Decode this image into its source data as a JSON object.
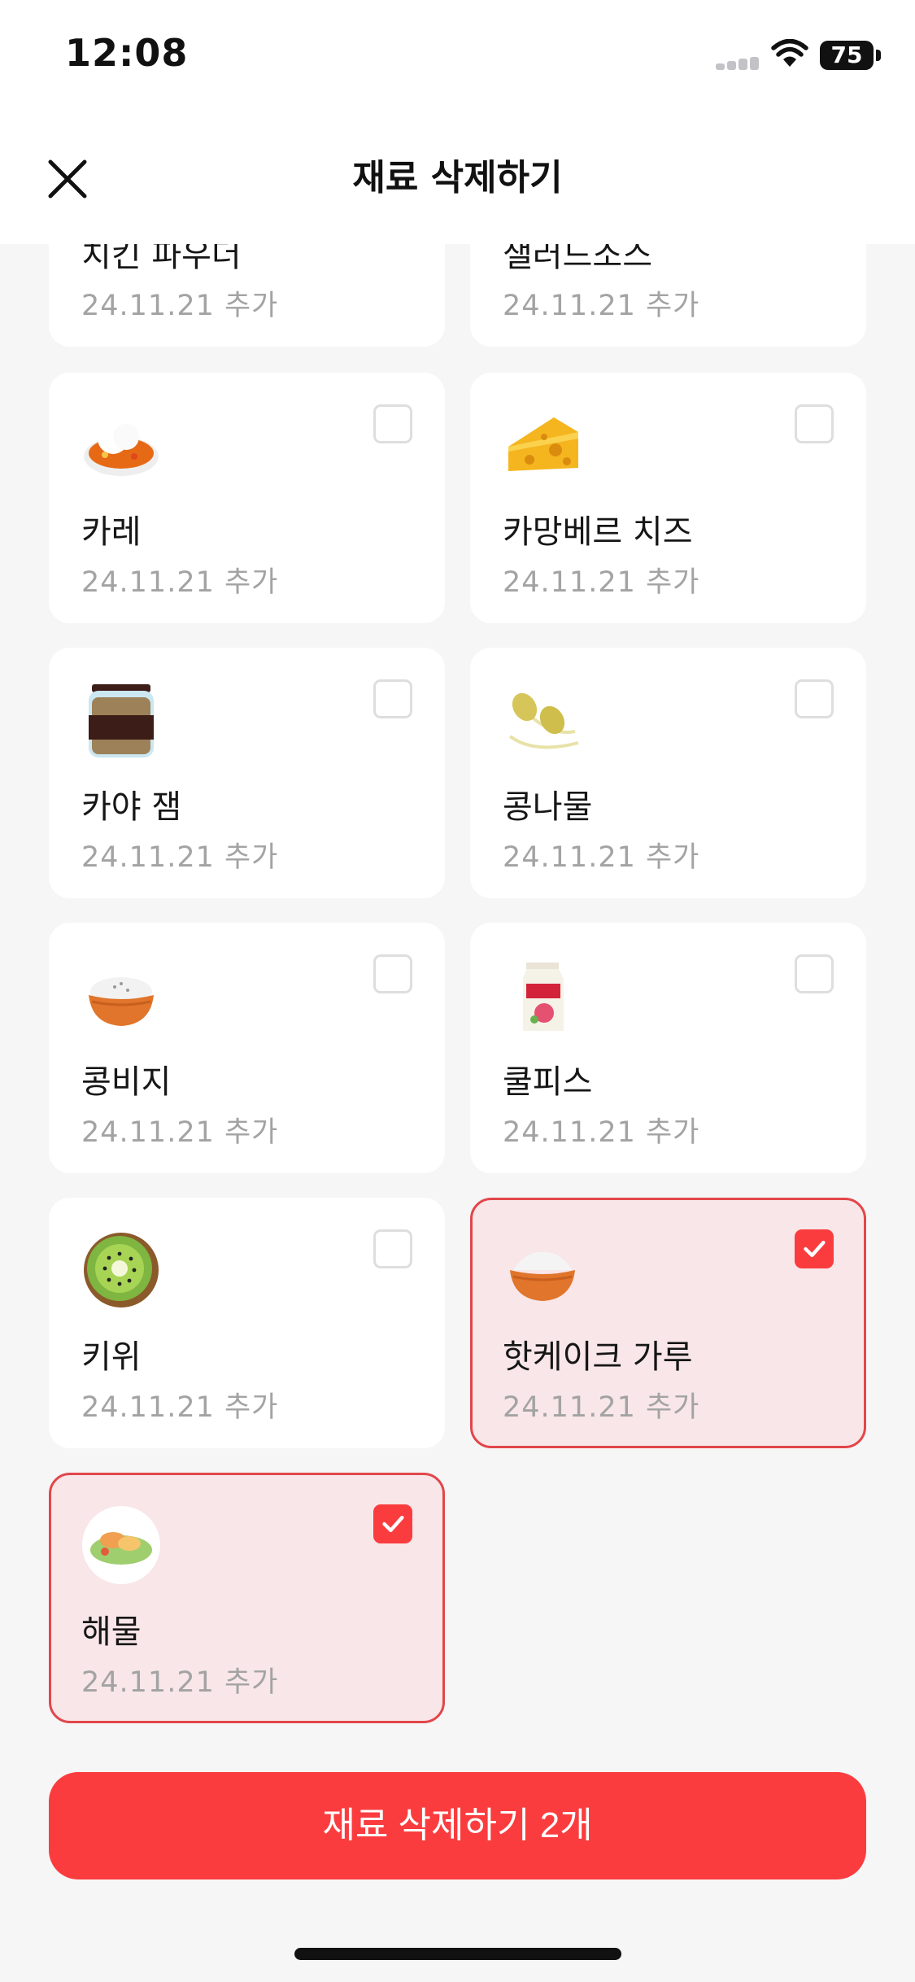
{
  "status_bar": {
    "time": "12:08",
    "battery": "75",
    "icons": [
      "signal-icon",
      "wifi-icon",
      "battery-icon"
    ]
  },
  "nav": {
    "title": "재료 삭제하기",
    "close_icon": "close-icon"
  },
  "ingredients": [
    {
      "name": "치킨 파우더",
      "date": "24.11.21  추가",
      "icon": "powder-bowl",
      "selected": false
    },
    {
      "name": "샐러드소스",
      "date": "24.11.21  추가",
      "icon": "sauce",
      "selected": false
    },
    {
      "name": "카레",
      "date": "24.11.21  추가",
      "icon": "curry-rice",
      "selected": false
    },
    {
      "name": "카망베르 치즈",
      "date": "24.11.21  추가",
      "icon": "cheese",
      "selected": false
    },
    {
      "name": "카야 잼",
      "date": "24.11.21  추가",
      "icon": "jam-jar",
      "selected": false
    },
    {
      "name": "콩나물",
      "date": "24.11.21  추가",
      "icon": "bean-sprouts",
      "selected": false
    },
    {
      "name": "콩비지",
      "date": "24.11.21  추가",
      "icon": "powder-bowl",
      "selected": false
    },
    {
      "name": "쿨피스",
      "date": "24.11.21  추가",
      "icon": "juice-carton",
      "selected": false
    },
    {
      "name": "키위",
      "date": "24.11.21  추가",
      "icon": "kiwi",
      "selected": false
    },
    {
      "name": "핫케이크 가루",
      "date": "24.11.21  추가",
      "icon": "flour-bowl",
      "selected": true
    },
    {
      "name": "해물",
      "date": "24.11.21  추가",
      "icon": "seafood-plate",
      "selected": true
    }
  ],
  "footer": {
    "delete_label": "재료 삭제하기 2개"
  },
  "colors": {
    "accent": "#fb3c3e",
    "selected_bg": "#f8e6e8",
    "selected_border": "#e2464a",
    "page_bg": "#f6f6f7",
    "muted_text": "#a3a3a3"
  }
}
